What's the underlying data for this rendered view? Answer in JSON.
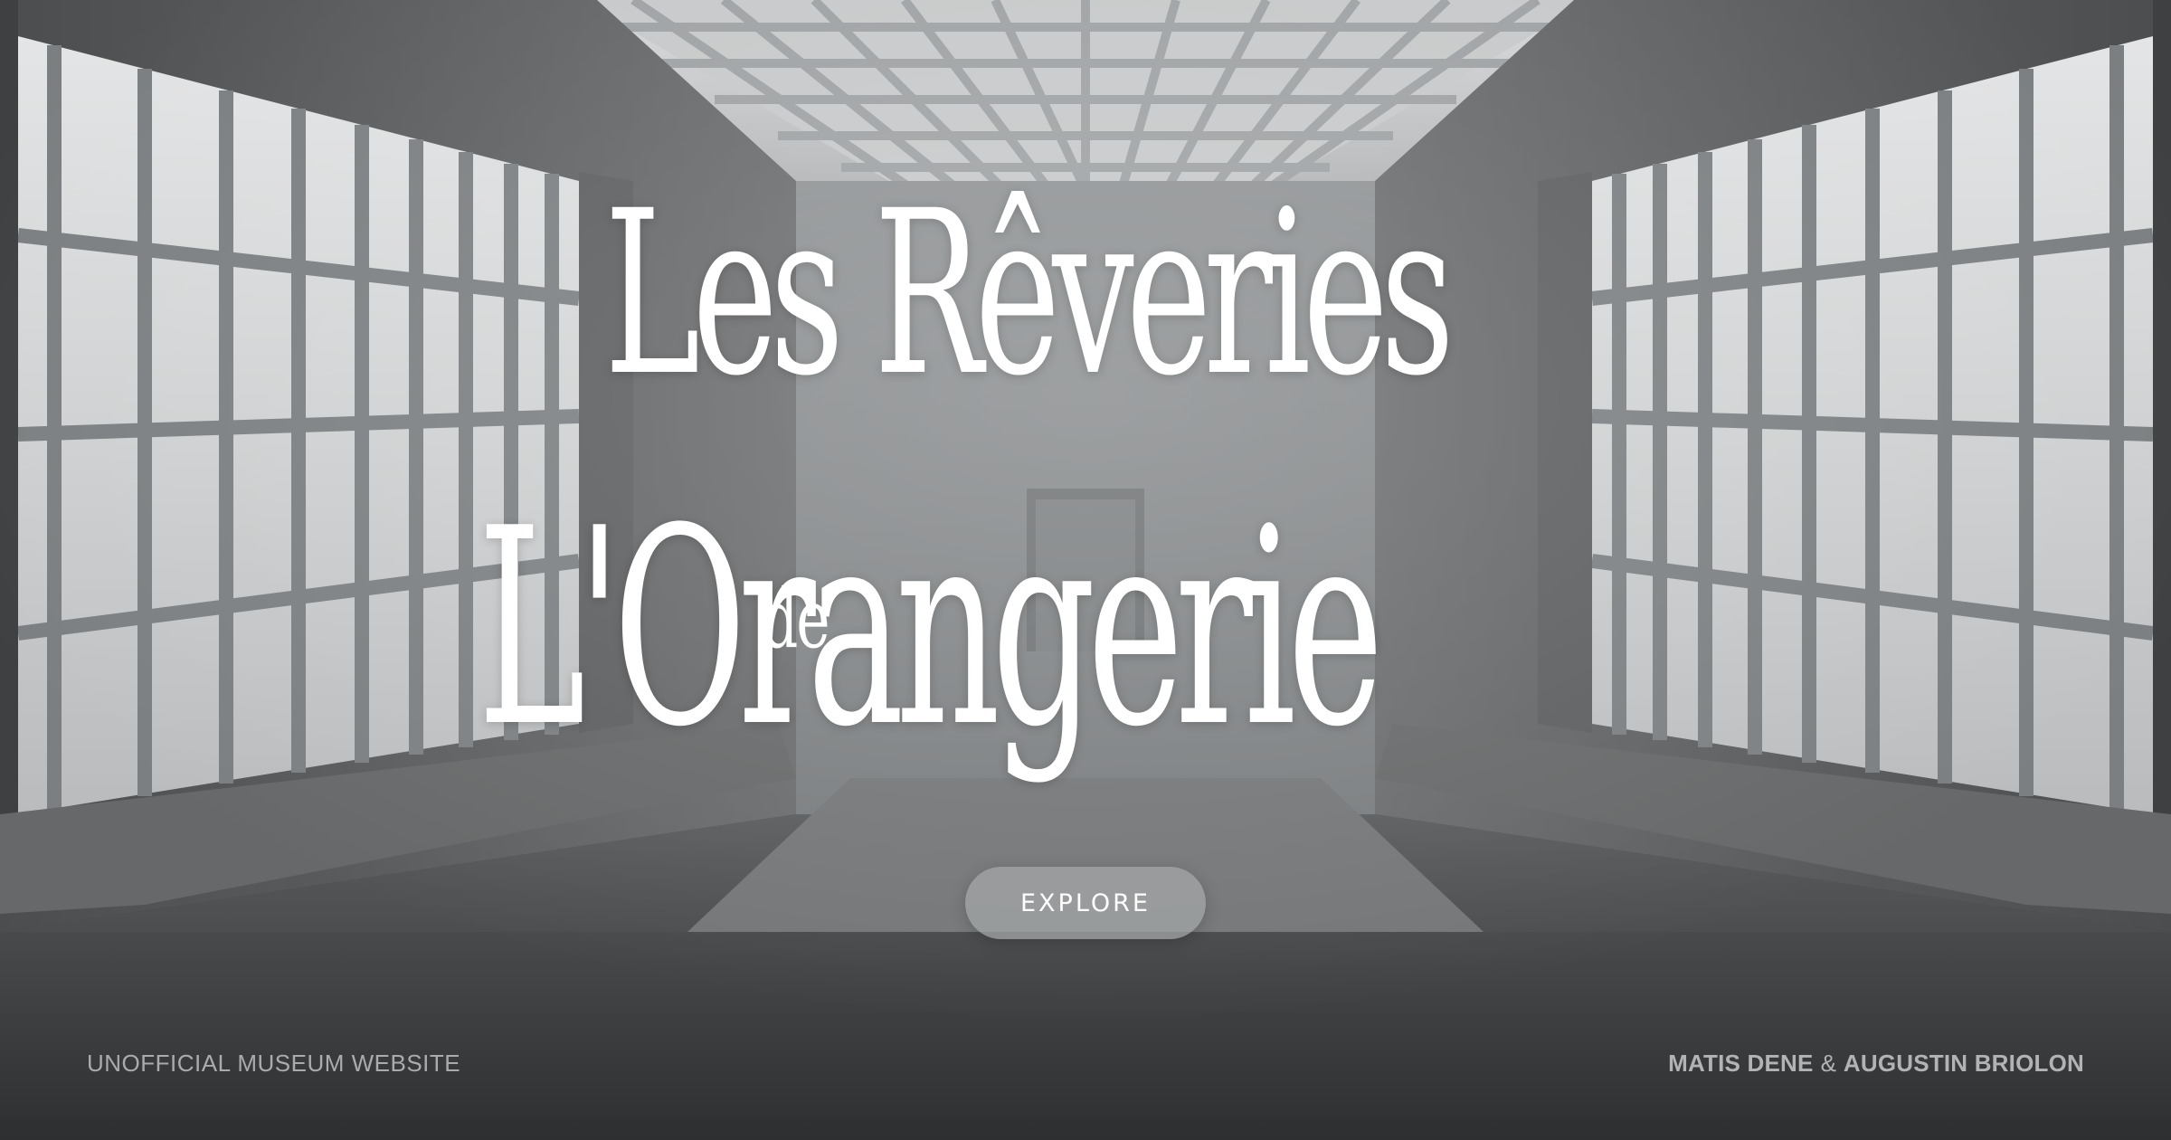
{
  "hero": {
    "title_line_1": "Les Rêveries",
    "title_line_2": "L'Orangerie",
    "title_connector": "de"
  },
  "cta": {
    "label": "EXPLORE"
  },
  "footer": {
    "tagline": "UNOFFICIAL MUSEUM WEBSITE",
    "author_1": "MATIS DENE",
    "separator": "&",
    "author_2": "AUGUSTIN BRIOLON"
  },
  "colors": {
    "title": "#ffffff",
    "button_bg": "#a5a7a9",
    "footer_text": "#a9abad",
    "floor": "#3a3b3c"
  }
}
